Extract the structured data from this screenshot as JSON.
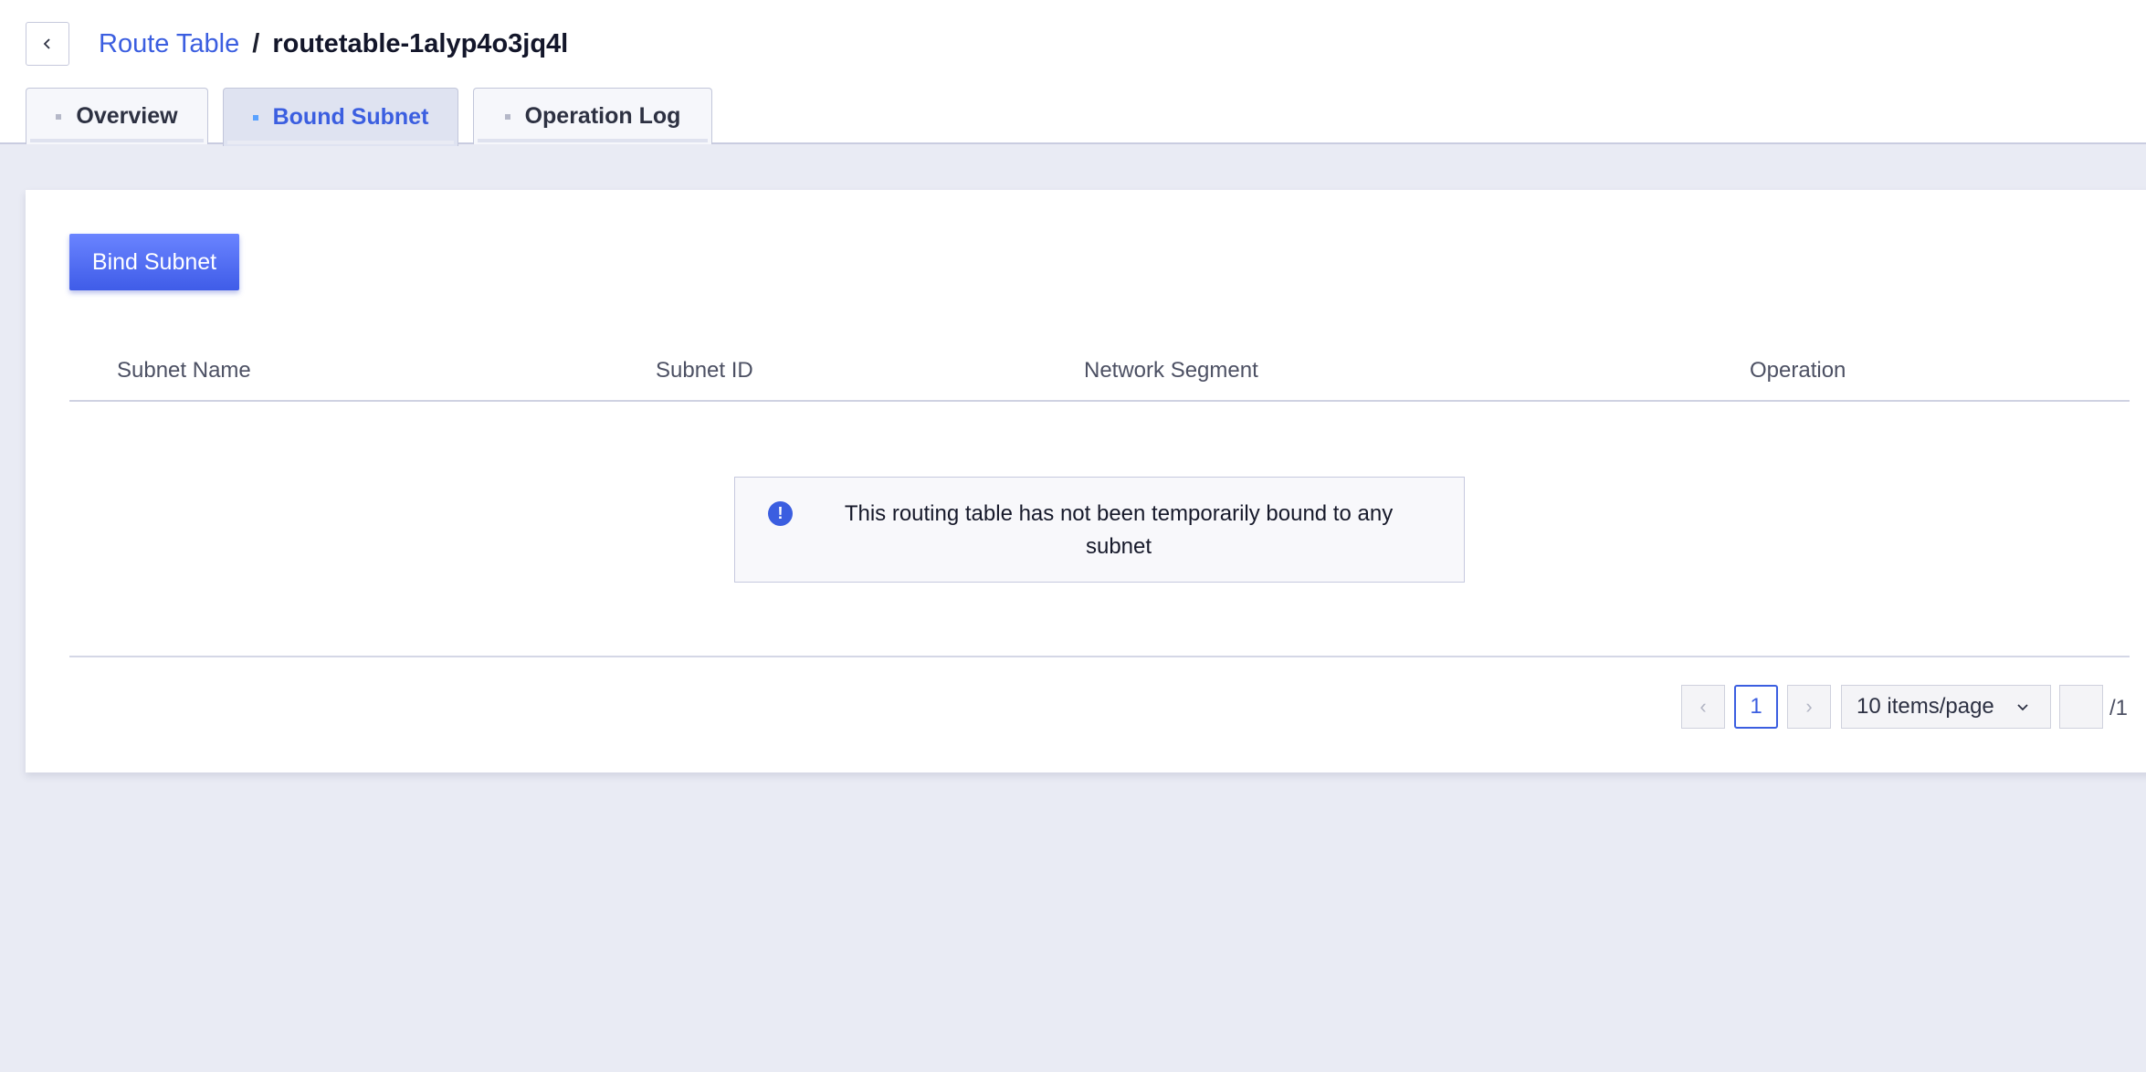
{
  "breadcrumb": {
    "parent": "Route Table",
    "separator": "/",
    "current": "routetable-1alyp4o3jq4l"
  },
  "tabs": [
    {
      "label": "Overview",
      "active": false
    },
    {
      "label": "Bound Subnet",
      "active": true
    },
    {
      "label": "Operation Log",
      "active": false
    }
  ],
  "toolbar": {
    "bind_label": "Bind Subnet"
  },
  "table": {
    "columns": [
      "Subnet Name",
      "Subnet ID",
      "Network Segment",
      "Operation"
    ],
    "rows": [],
    "empty_message": "This routing table has not been temporarily bound to any subnet"
  },
  "pagination": {
    "prev": "‹",
    "next": "›",
    "current_page": "1",
    "page_size": "10 items/page",
    "jump_value": "",
    "total_pages": "/1"
  },
  "colors": {
    "accent": "#3b5ee0",
    "background": "#e9ebf4",
    "active_tab_dot": "#5aa2ff"
  },
  "icons": {
    "back": "chevron-left-icon",
    "info": "info-icon",
    "dropdown": "chevron-down-icon"
  }
}
